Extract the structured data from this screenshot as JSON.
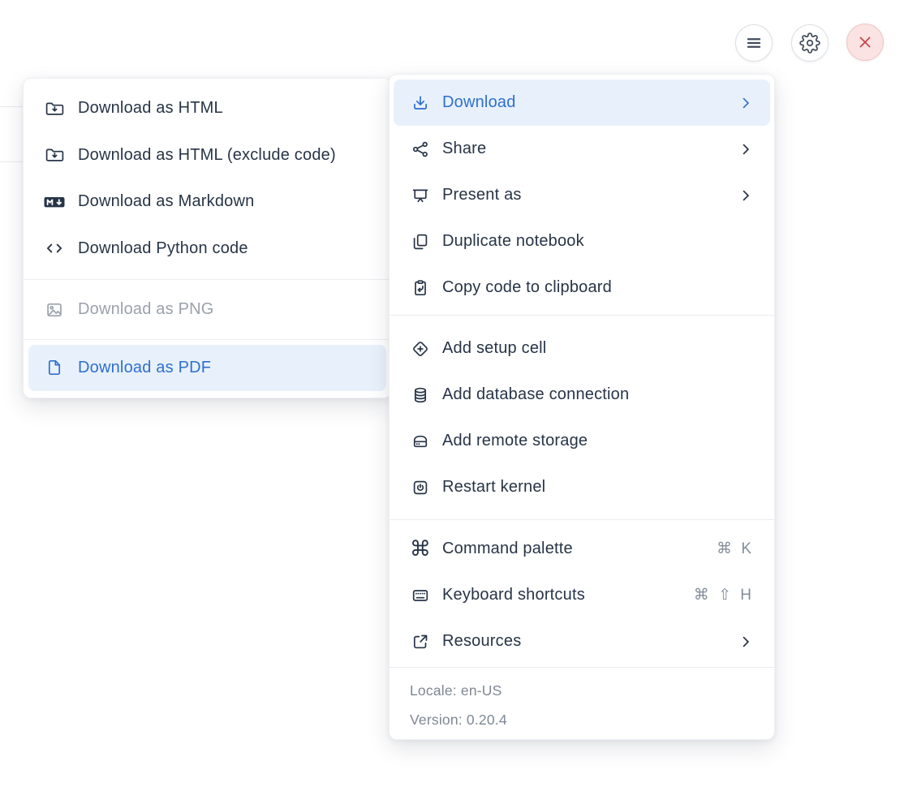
{
  "toolbar": {
    "icons": [
      {
        "name": "hamburger-icon"
      },
      {
        "name": "gear-icon"
      },
      {
        "name": "close-icon"
      }
    ]
  },
  "main_menu": {
    "items": [
      {
        "label": "Download",
        "icon": "download-icon",
        "has_submenu": true,
        "state": "active"
      },
      {
        "label": "Share",
        "icon": "share-icon",
        "has_submenu": true
      },
      {
        "label": "Present as",
        "icon": "presentation-icon",
        "has_submenu": true
      },
      {
        "label": "Duplicate notebook",
        "icon": "duplicate-icon"
      },
      {
        "label": "Copy code to clipboard",
        "icon": "clipboard-copy-icon"
      },
      {
        "label": "Add setup cell",
        "icon": "diamond-plus-icon"
      },
      {
        "label": "Add database connection",
        "icon": "database-icon"
      },
      {
        "label": "Add remote storage",
        "icon": "storage-drive-icon"
      },
      {
        "label": "Restart kernel",
        "icon": "power-icon"
      },
      {
        "label": "Command palette",
        "icon": "command-icon",
        "shortcut": "⌘ K"
      },
      {
        "label": "Keyboard shortcuts",
        "icon": "keyboard-icon",
        "shortcut": "⌘ ⇧ H"
      },
      {
        "label": "Resources",
        "icon": "external-link-icon",
        "has_submenu": true
      }
    ],
    "footer": {
      "locale": "Locale: en-US",
      "version": "Version: 0.20.4"
    }
  },
  "download_submenu": {
    "items": [
      {
        "label": "Download as HTML",
        "icon": "folder-download-icon"
      },
      {
        "label": "Download as HTML (exclude code)",
        "icon": "folder-download-icon"
      },
      {
        "label": "Download as Markdown",
        "icon": "markdown-icon"
      },
      {
        "label": "Download Python code",
        "icon": "code-icon"
      },
      {
        "label": "Download as PNG",
        "icon": "image-icon",
        "state": "disabled"
      },
      {
        "label": "Download as PDF",
        "icon": "file-icon",
        "state": "active"
      }
    ]
  },
  "colors": {
    "accent_blue": "#2E6FD0",
    "highlight_bg": "#E8F1FB",
    "text": "#273447",
    "shortcut_gray": "#848D9C",
    "footer_gray": "#7E8794",
    "disabled_gray": "#9AA1AC",
    "danger": "#C8424B",
    "danger_bg": "#FAE3E2"
  }
}
